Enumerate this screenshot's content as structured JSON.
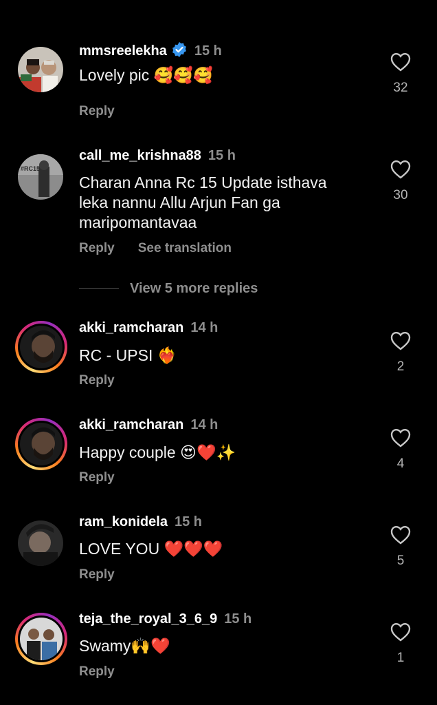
{
  "comments": [
    {
      "username": "mmsreelekha",
      "time": "15 h",
      "verified": true,
      "text": "Lovely pic 🥰🥰🥰",
      "reply": "Reply",
      "likes": "32",
      "avatar_style": "plain"
    },
    {
      "username": "call_me_krishna88",
      "time": "15 h",
      "verified": false,
      "text": "Charan Anna Rc 15 Update isthava leka nannu Allu Arjun Fan ga maripomantavaa",
      "reply": "Reply",
      "translate": "See translation",
      "likes": "30",
      "avatar_style": "plain",
      "avatar_text": "#RC15"
    },
    {
      "username": "akki_ramcharan",
      "time": "14 h",
      "verified": false,
      "text": "RC - UPSI ❤️‍🔥",
      "reply": "Reply",
      "likes": "2",
      "avatar_style": "story"
    },
    {
      "username": "akki_ramcharan",
      "time": "14 h",
      "verified": false,
      "text": "Happy couple 😍❤️✨",
      "reply": "Reply",
      "likes": "4",
      "avatar_style": "story"
    },
    {
      "username": "ram_konidela",
      "time": "15 h",
      "verified": false,
      "text": "LOVE YOU ❤️❤️❤️",
      "reply": "Reply",
      "likes": "5",
      "avatar_style": "plain"
    },
    {
      "username": "teja_the_royal_3_6_9",
      "time": "15 h",
      "verified": false,
      "text": "Swamy🙌❤️",
      "reply": "Reply",
      "likes": "1",
      "avatar_style": "story"
    }
  ],
  "view_more_replies": "View 5 more replies",
  "colors": {
    "background": "#000000",
    "muted": "#8e8e8e",
    "verified": "#3897f0"
  }
}
